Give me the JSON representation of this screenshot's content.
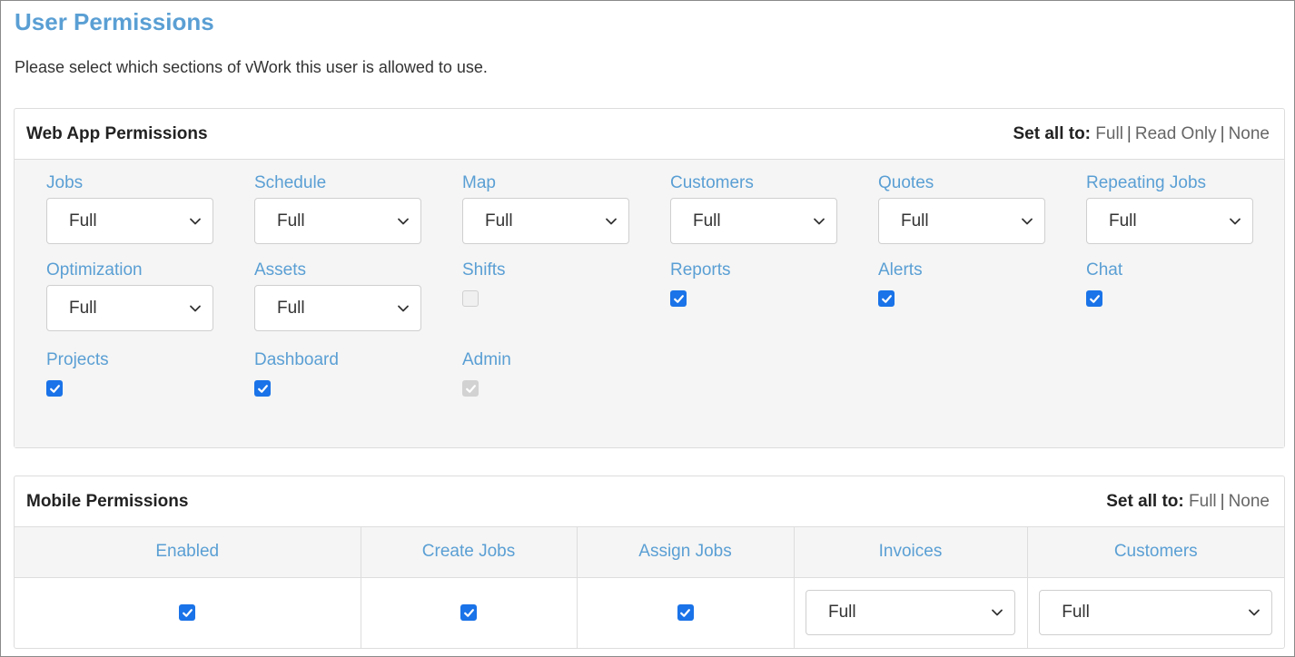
{
  "page": {
    "title": "User Permissions",
    "subtitle": "Please select which sections of vWork this user is allowed to use."
  },
  "web": {
    "title": "Web App Permissions",
    "set_all_label": "Set all to:",
    "set_all_options": [
      "Full",
      "Read Only",
      "None"
    ],
    "items": [
      {
        "label": "Jobs",
        "type": "select",
        "value": "Full"
      },
      {
        "label": "Schedule",
        "type": "select",
        "value": "Full"
      },
      {
        "label": "Map",
        "type": "select",
        "value": "Full"
      },
      {
        "label": "Customers",
        "type": "select",
        "value": "Full"
      },
      {
        "label": "Quotes",
        "type": "select",
        "value": "Full"
      },
      {
        "label": "Repeating Jobs",
        "type": "select",
        "value": "Full"
      },
      {
        "label": "Optimization",
        "type": "select",
        "value": "Full"
      },
      {
        "label": "Assets",
        "type": "select",
        "value": "Full"
      },
      {
        "label": "Shifts",
        "type": "checkbox",
        "checked": false,
        "disabled": true
      },
      {
        "label": "Reports",
        "type": "checkbox",
        "checked": true,
        "disabled": false
      },
      {
        "label": "Alerts",
        "type": "checkbox",
        "checked": true,
        "disabled": false
      },
      {
        "label": "Chat",
        "type": "checkbox",
        "checked": true,
        "disabled": false
      },
      {
        "label": "Projects",
        "type": "checkbox",
        "checked": true,
        "disabled": false
      },
      {
        "label": "Dashboard",
        "type": "checkbox",
        "checked": true,
        "disabled": false
      },
      {
        "label": "Admin",
        "type": "checkbox",
        "checked": true,
        "disabled": true
      }
    ]
  },
  "mobile": {
    "title": "Mobile Permissions",
    "set_all_label": "Set all to:",
    "set_all_options": [
      "Full",
      "None"
    ],
    "columns": [
      {
        "label": "Enabled",
        "type": "checkbox",
        "checked": true
      },
      {
        "label": "Create Jobs",
        "type": "checkbox",
        "checked": true
      },
      {
        "label": "Assign Jobs",
        "type": "checkbox",
        "checked": true
      },
      {
        "label": "Invoices",
        "type": "select",
        "value": "Full"
      },
      {
        "label": "Customers",
        "type": "select",
        "value": "Full"
      }
    ]
  },
  "colors": {
    "accent": "#5a9fd4",
    "checkbox": "#1a73e8"
  }
}
